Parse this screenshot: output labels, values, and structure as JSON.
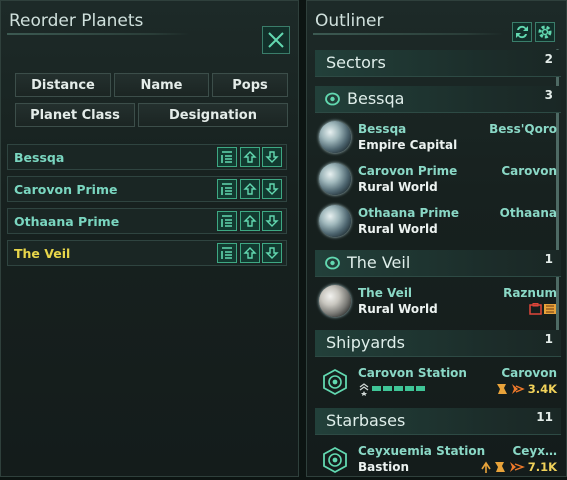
{
  "reorder": {
    "title": "Reorder Planets",
    "sort_buttons": [
      "Distance",
      "Name",
      "Pops",
      "Planet Class",
      "Designation"
    ],
    "planets": [
      {
        "name": "Bessqa",
        "selected": false
      },
      {
        "name": "Carovon Prime",
        "selected": false
      },
      {
        "name": "Othaana Prime",
        "selected": false
      },
      {
        "name": "The Veil",
        "selected": true
      }
    ]
  },
  "outliner": {
    "title": "Outliner",
    "sectors": {
      "label": "Sectors",
      "count": "2"
    },
    "bessqa_sector": {
      "label": "Bessqa",
      "count": "3"
    },
    "bessqa_planets": [
      {
        "name": "Bessqa",
        "system": "Bess'Qoro",
        "type": "Empire Capital"
      },
      {
        "name": "Carovon Prime",
        "system": "Carovon",
        "type": "Rural World"
      },
      {
        "name": "Othaana Prime",
        "system": "Othaana",
        "type": "Rural World"
      }
    ],
    "veil_sector": {
      "label": "The Veil",
      "count": "1"
    },
    "veil_planets": [
      {
        "name": "The Veil",
        "system": "Raznum",
        "type": "Rural World"
      }
    ],
    "shipyards": {
      "label": "Shipyards",
      "count": "1"
    },
    "shipyard_items": [
      {
        "name": "Carovon Station",
        "system": "Carovon",
        "value": "3.4K"
      }
    ],
    "starbases": {
      "label": "Starbases",
      "count": "11"
    },
    "starbase_items": [
      {
        "name": "Ceyxuemia Station",
        "system": "Ceyx…",
        "type": "Bastion",
        "value": "7.1K"
      }
    ]
  },
  "colors": {
    "accent": "#3ea883",
    "highlight": "#e8d64a",
    "name_text": "#8ad8c6"
  }
}
